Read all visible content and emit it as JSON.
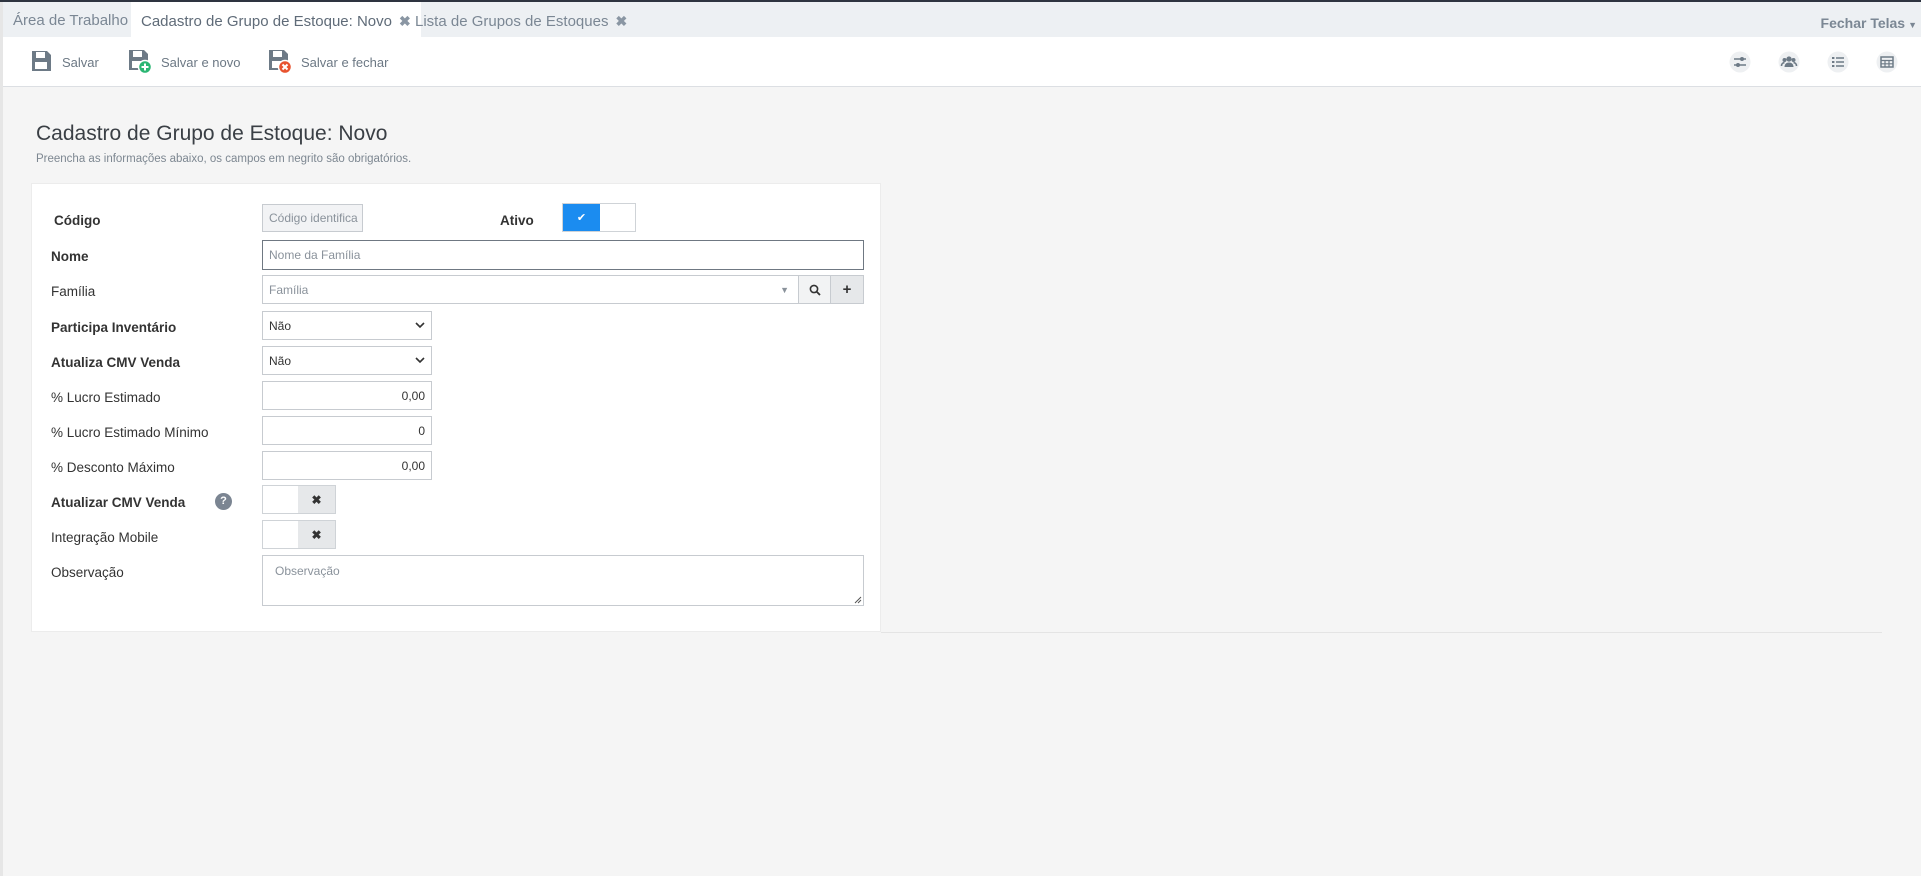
{
  "tabs": [
    {
      "label": "Área de Trabalho"
    },
    {
      "label": "Cadastro de Grupo de Estoque: Novo"
    },
    {
      "label": "Lista de Grupos de Estoques"
    }
  ],
  "tab_close_glyph": "✖",
  "close_all": {
    "label": "Fechar Telas"
  },
  "toolbar": {
    "save": "Salvar",
    "save_new": "Salvar e novo",
    "save_close": "Salvar e fechar",
    "right_icons": [
      "sliders-icon",
      "users-icon",
      "list-icon",
      "table-icon"
    ]
  },
  "page": {
    "title": "Cadastro de Grupo de Estoque: Novo",
    "subtitle": "Preencha as informações abaixo, os campos em negrito são obrigatórios."
  },
  "form": {
    "codigo": {
      "label": "Código",
      "placeholder": "Código identifica"
    },
    "ativo": {
      "label": "Ativo",
      "checked": true
    },
    "nome": {
      "label": "Nome",
      "placeholder": "Nome da Família"
    },
    "familia": {
      "label": "Família",
      "placeholder": "Família"
    },
    "participa_inventario": {
      "label": "Participa Inventário",
      "value": "Não"
    },
    "atualiza_cmv_venda": {
      "label": "Atualiza CMV Venda",
      "value": "Não"
    },
    "lucro_estimado": {
      "label": "% Lucro Estimado",
      "value": "0,00"
    },
    "lucro_estimado_minimo": {
      "label": "% Lucro Estimado Mínimo",
      "value": "0"
    },
    "desconto_maximo": {
      "label": "% Desconto Máximo",
      "value": "0,00"
    },
    "atualizar_cmv_venda": {
      "label": "Atualizar CMV Venda",
      "checked": false,
      "help": "?"
    },
    "integracao_mobile": {
      "label": "Integração Mobile",
      "checked": false
    },
    "observacao": {
      "label": "Observação",
      "placeholder": "Observação"
    }
  },
  "colors": {
    "accent": "#1b8cf0",
    "save_new": "#2bb673",
    "save_close": "#e8532f"
  }
}
